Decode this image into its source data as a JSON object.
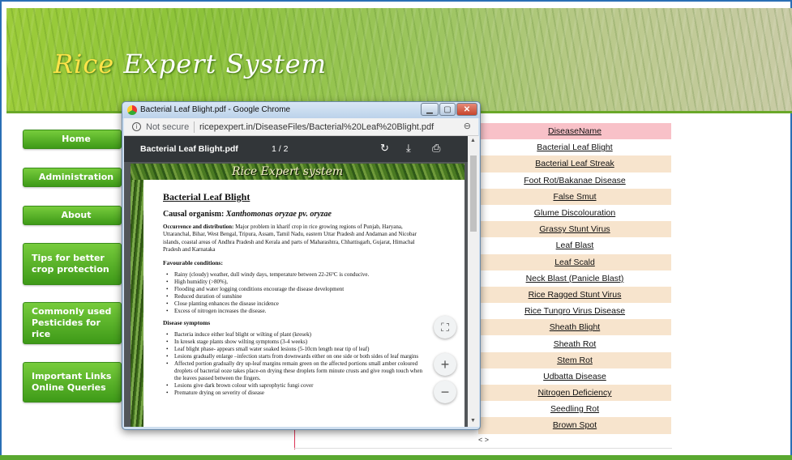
{
  "site": {
    "title_first": "Rice",
    "title_rest": " Expert System"
  },
  "nav": [
    {
      "label": "Home"
    },
    {
      "label": "Administration"
    },
    {
      "label": "About"
    },
    {
      "label": "Tips for better crop protection"
    },
    {
      "label": "Commonly used Pesticides for rice"
    },
    {
      "label": "Important Links Online Queries"
    }
  ],
  "table": {
    "header": "DiseaseName",
    "rows": [
      "Bacterial Leaf Blight",
      "Bacterial Leaf Streak",
      "Foot Rot/Bakanae Disease",
      "False Smut",
      "Glume Discolouration",
      "Grassy Stunt Virus",
      "Leaf Blast",
      "Leaf Scald",
      "Neck Blast (Panicle Blast)",
      "Rice Ragged Stunt Virus",
      "Rice Tungro Virus Disease",
      "Sheath Blight",
      "Sheath Rot",
      "Stem Rot",
      "Udbatta Disease",
      "Nitrogen Deficiency",
      "Seedling Rot",
      "Brown Spot"
    ],
    "pager": "< >"
  },
  "popup": {
    "window_title": "Bacterial Leaf Blight.pdf - Google Chrome",
    "not_secure": "Not secure",
    "url": "ricepexpert.in/DiseaseFiles/Bacterial%20Leaf%20Blight.pdf",
    "pdf_name": "Bacterial Leaf Blight.pdf",
    "page_indicator": "1 / 2",
    "pdf_header": "Rice Expert system",
    "heading": "Bacterial Leaf Blight",
    "causal_label": "Causal organism:",
    "causal_value": "Xanthomonas oryzae pv. oryzae",
    "occurrence_label": "Occurrence and distribution:",
    "occurrence_text": " Major problem in kharif crop in rice growing regions of Punjab, Haryana, Uttaranchal, Bihar, West Bengal, Tripura, Assam, Tamil Nadu, eastern Uttar Pradesh and Andaman and Nicobar islands, coastal areas of Andhra Pradesh and Kerala and parts of Maharashtra, Chhattisgarh, Gujarat, Himachal Pradesh and Karnataka",
    "favourable_label": "Favourable conditions:",
    "favourable": [
      "Rainy (cloudy) weather, dull windy days, temperature between 22-26°C is conducive.",
      "High humidity (>80%),",
      "Flooding and water logging conditions encourage the disease development",
      "Reduced duration of sunshine",
      "Close planting enhances the disease incidence",
      "Excess of nitrogen increases the disease."
    ],
    "symptoms_label": "Disease symptoms",
    "symptoms": [
      "Bacteria induce either leaf blight or wilting of plant (kresek)",
      "In kresek stage plants show wilting symptoms (3-4 weeks)",
      "Leaf blight phase- appears small water soaked lesions (5-10cm length near tip of leaf)",
      "Lesions gradually enlarge –infection starts from downwards either on one side or both sides of leaf margins",
      "Affected portion gradually dry up-leaf margins remain green on the affected portions small amber coloured droplets of bacterial ooze takes place-on drying these droplets form minute crusts and give rough touch when the leaves passed between the fingers.",
      "Lesions give dark brown colour with saprophytic fungi cover",
      "Premature drying on severity of disease"
    ]
  },
  "icons": {
    "info": "info-icon",
    "rotate": "rotate-icon",
    "download": "download-icon",
    "print": "print-icon",
    "fit": "fit-page-icon",
    "zoom_in": "zoom-in-icon",
    "zoom_out": "zoom-out-icon"
  },
  "colors": {
    "nav_green": "#4aa822",
    "table_header": "#f8c1c8",
    "table_alt": "#f7e4cd",
    "pdf_toolbar": "#323639"
  }
}
